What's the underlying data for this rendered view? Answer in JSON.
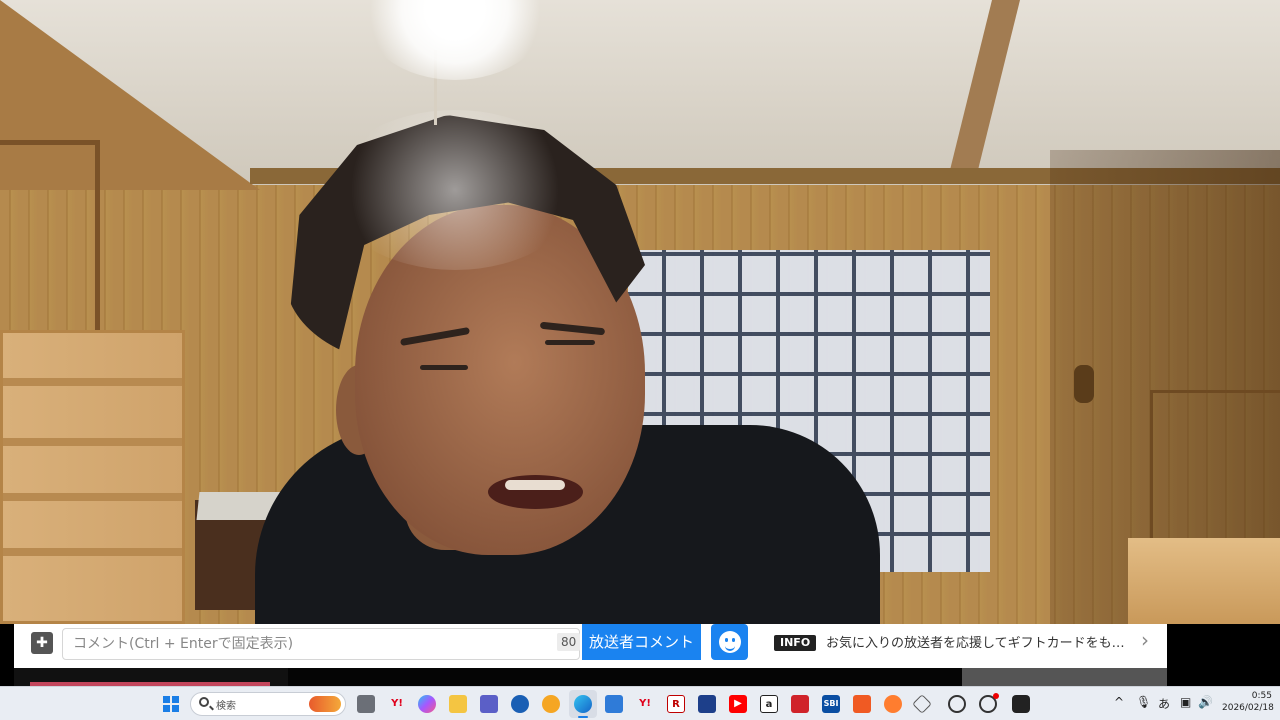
{
  "comment_bar": {
    "input_placeholder": "コメント(Ctrl + Enterで固定表示)",
    "char_count": "80",
    "broadcaster_comment_label": "放送者コメント",
    "info_badge": "INFO",
    "info_text": "お気に入りの放送者を応援してギフトカードをも…"
  },
  "taskbar": {
    "search_label": "検索",
    "ime_label": "あ",
    "time": "0:55",
    "date": "2026/02/18"
  },
  "colors": {
    "accent_blue": "#1a83f0",
    "progress_pink": "#c3465c"
  }
}
